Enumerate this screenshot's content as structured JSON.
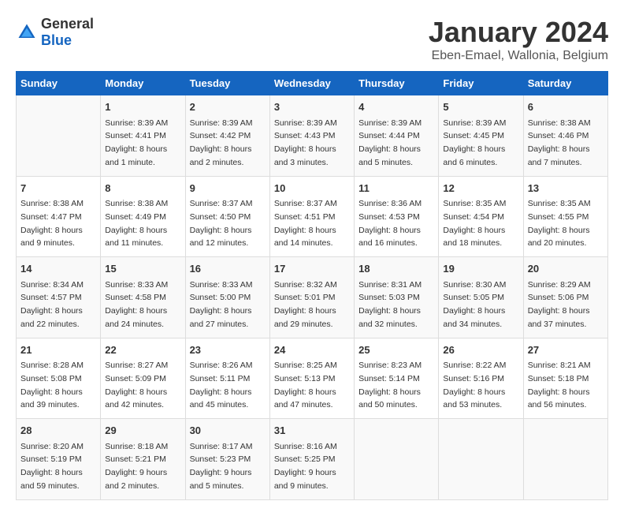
{
  "header": {
    "logo_general": "General",
    "logo_blue": "Blue",
    "title": "January 2024",
    "subtitle": "Eben-Emael, Wallonia, Belgium"
  },
  "calendar": {
    "days": [
      "Sunday",
      "Monday",
      "Tuesday",
      "Wednesday",
      "Thursday",
      "Friday",
      "Saturday"
    ],
    "weeks": [
      [
        {
          "day": "",
          "sunrise": "",
          "sunset": "",
          "daylight": ""
        },
        {
          "day": "1",
          "sunrise": "Sunrise: 8:39 AM",
          "sunset": "Sunset: 4:41 PM",
          "daylight": "Daylight: 8 hours and 1 minute."
        },
        {
          "day": "2",
          "sunrise": "Sunrise: 8:39 AM",
          "sunset": "Sunset: 4:42 PM",
          "daylight": "Daylight: 8 hours and 2 minutes."
        },
        {
          "day": "3",
          "sunrise": "Sunrise: 8:39 AM",
          "sunset": "Sunset: 4:43 PM",
          "daylight": "Daylight: 8 hours and 3 minutes."
        },
        {
          "day": "4",
          "sunrise": "Sunrise: 8:39 AM",
          "sunset": "Sunset: 4:44 PM",
          "daylight": "Daylight: 8 hours and 5 minutes."
        },
        {
          "day": "5",
          "sunrise": "Sunrise: 8:39 AM",
          "sunset": "Sunset: 4:45 PM",
          "daylight": "Daylight: 8 hours and 6 minutes."
        },
        {
          "day": "6",
          "sunrise": "Sunrise: 8:38 AM",
          "sunset": "Sunset: 4:46 PM",
          "daylight": "Daylight: 8 hours and 7 minutes."
        }
      ],
      [
        {
          "day": "7",
          "sunrise": "Sunrise: 8:38 AM",
          "sunset": "Sunset: 4:47 PM",
          "daylight": "Daylight: 8 hours and 9 minutes."
        },
        {
          "day": "8",
          "sunrise": "Sunrise: 8:38 AM",
          "sunset": "Sunset: 4:49 PM",
          "daylight": "Daylight: 8 hours and 11 minutes."
        },
        {
          "day": "9",
          "sunrise": "Sunrise: 8:37 AM",
          "sunset": "Sunset: 4:50 PM",
          "daylight": "Daylight: 8 hours and 12 minutes."
        },
        {
          "day": "10",
          "sunrise": "Sunrise: 8:37 AM",
          "sunset": "Sunset: 4:51 PM",
          "daylight": "Daylight: 8 hours and 14 minutes."
        },
        {
          "day": "11",
          "sunrise": "Sunrise: 8:36 AM",
          "sunset": "Sunset: 4:53 PM",
          "daylight": "Daylight: 8 hours and 16 minutes."
        },
        {
          "day": "12",
          "sunrise": "Sunrise: 8:35 AM",
          "sunset": "Sunset: 4:54 PM",
          "daylight": "Daylight: 8 hours and 18 minutes."
        },
        {
          "day": "13",
          "sunrise": "Sunrise: 8:35 AM",
          "sunset": "Sunset: 4:55 PM",
          "daylight": "Daylight: 8 hours and 20 minutes."
        }
      ],
      [
        {
          "day": "14",
          "sunrise": "Sunrise: 8:34 AM",
          "sunset": "Sunset: 4:57 PM",
          "daylight": "Daylight: 8 hours and 22 minutes."
        },
        {
          "day": "15",
          "sunrise": "Sunrise: 8:33 AM",
          "sunset": "Sunset: 4:58 PM",
          "daylight": "Daylight: 8 hours and 24 minutes."
        },
        {
          "day": "16",
          "sunrise": "Sunrise: 8:33 AM",
          "sunset": "Sunset: 5:00 PM",
          "daylight": "Daylight: 8 hours and 27 minutes."
        },
        {
          "day": "17",
          "sunrise": "Sunrise: 8:32 AM",
          "sunset": "Sunset: 5:01 PM",
          "daylight": "Daylight: 8 hours and 29 minutes."
        },
        {
          "day": "18",
          "sunrise": "Sunrise: 8:31 AM",
          "sunset": "Sunset: 5:03 PM",
          "daylight": "Daylight: 8 hours and 32 minutes."
        },
        {
          "day": "19",
          "sunrise": "Sunrise: 8:30 AM",
          "sunset": "Sunset: 5:05 PM",
          "daylight": "Daylight: 8 hours and 34 minutes."
        },
        {
          "day": "20",
          "sunrise": "Sunrise: 8:29 AM",
          "sunset": "Sunset: 5:06 PM",
          "daylight": "Daylight: 8 hours and 37 minutes."
        }
      ],
      [
        {
          "day": "21",
          "sunrise": "Sunrise: 8:28 AM",
          "sunset": "Sunset: 5:08 PM",
          "daylight": "Daylight: 8 hours and 39 minutes."
        },
        {
          "day": "22",
          "sunrise": "Sunrise: 8:27 AM",
          "sunset": "Sunset: 5:09 PM",
          "daylight": "Daylight: 8 hours and 42 minutes."
        },
        {
          "day": "23",
          "sunrise": "Sunrise: 8:26 AM",
          "sunset": "Sunset: 5:11 PM",
          "daylight": "Daylight: 8 hours and 45 minutes."
        },
        {
          "day": "24",
          "sunrise": "Sunrise: 8:25 AM",
          "sunset": "Sunset: 5:13 PM",
          "daylight": "Daylight: 8 hours and 47 minutes."
        },
        {
          "day": "25",
          "sunrise": "Sunrise: 8:23 AM",
          "sunset": "Sunset: 5:14 PM",
          "daylight": "Daylight: 8 hours and 50 minutes."
        },
        {
          "day": "26",
          "sunrise": "Sunrise: 8:22 AM",
          "sunset": "Sunset: 5:16 PM",
          "daylight": "Daylight: 8 hours and 53 minutes."
        },
        {
          "day": "27",
          "sunrise": "Sunrise: 8:21 AM",
          "sunset": "Sunset: 5:18 PM",
          "daylight": "Daylight: 8 hours and 56 minutes."
        }
      ],
      [
        {
          "day": "28",
          "sunrise": "Sunrise: 8:20 AM",
          "sunset": "Sunset: 5:19 PM",
          "daylight": "Daylight: 8 hours and 59 minutes."
        },
        {
          "day": "29",
          "sunrise": "Sunrise: 8:18 AM",
          "sunset": "Sunset: 5:21 PM",
          "daylight": "Daylight: 9 hours and 2 minutes."
        },
        {
          "day": "30",
          "sunrise": "Sunrise: 8:17 AM",
          "sunset": "Sunset: 5:23 PM",
          "daylight": "Daylight: 9 hours and 5 minutes."
        },
        {
          "day": "31",
          "sunrise": "Sunrise: 8:16 AM",
          "sunset": "Sunset: 5:25 PM",
          "daylight": "Daylight: 9 hours and 9 minutes."
        },
        {
          "day": "",
          "sunrise": "",
          "sunset": "",
          "daylight": ""
        },
        {
          "day": "",
          "sunrise": "",
          "sunset": "",
          "daylight": ""
        },
        {
          "day": "",
          "sunrise": "",
          "sunset": "",
          "daylight": ""
        }
      ]
    ]
  }
}
